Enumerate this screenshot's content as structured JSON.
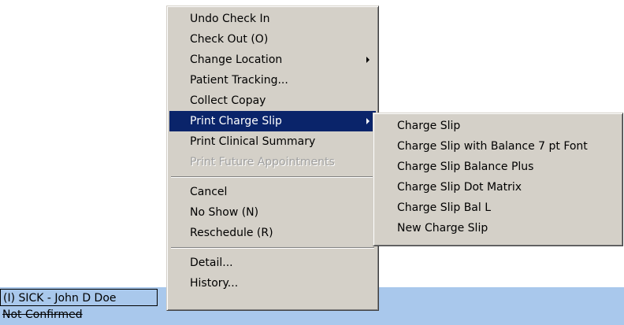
{
  "appointment": {
    "line1": "(I) SICK - John D Doe",
    "line2": "Not Confirmed"
  },
  "context_menu": {
    "items": [
      {
        "label": "Undo Check In"
      },
      {
        "label": "Check Out  (O)"
      },
      {
        "label": "Change Location"
      },
      {
        "label": "Patient Tracking..."
      },
      {
        "label": "Collect Copay"
      },
      {
        "label": "Print Charge Slip"
      },
      {
        "label": "Print Clinical Summary"
      },
      {
        "label": "Print Future Appointments"
      },
      {
        "label": "Cancel"
      },
      {
        "label": "No Show  (N)"
      },
      {
        "label": "Reschedule  (R)"
      },
      {
        "label": "Detail..."
      },
      {
        "label": "History..."
      }
    ],
    "colors": {
      "menu_bg": "#d4d0c8",
      "highlight_bg": "#0a246a",
      "highlight_text": "#ffffff",
      "disabled_text": "#a0a0a0",
      "row_bg": "#a9c8ec"
    }
  },
  "submenu": {
    "items": [
      {
        "label": "Charge Slip"
      },
      {
        "label": "Charge Slip with Balance 7 pt Font"
      },
      {
        "label": "Charge Slip Balance Plus"
      },
      {
        "label": "Charge Slip Dot Matrix"
      },
      {
        "label": "Charge Slip Bal L"
      },
      {
        "label": "New Charge Slip"
      }
    ]
  }
}
